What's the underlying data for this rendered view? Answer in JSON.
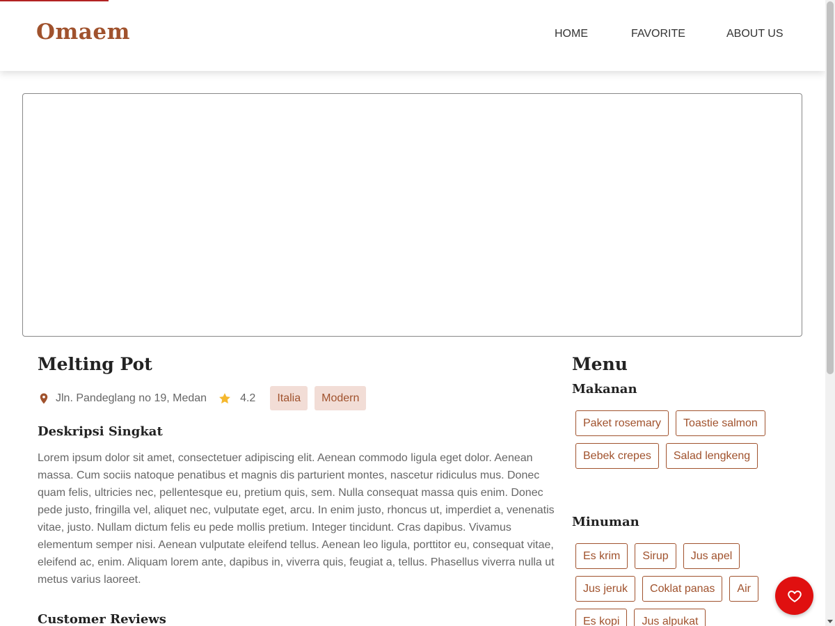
{
  "header": {
    "brand": "Omaem",
    "nav": [
      "HOME",
      "FAVORITE",
      "ABOUT US"
    ]
  },
  "restaurant": {
    "name": "Melting Pot",
    "address": "Jln. Pandeglang no 19, Medan",
    "rating": "4.2",
    "categories": [
      "Italia",
      "Modern"
    ],
    "description_heading": "Deskripsi Singkat",
    "description": "Lorem ipsum dolor sit amet, consectetuer adipiscing elit. Aenean commodo ligula eget dolor. Aenean massa. Cum sociis natoque penatibus et magnis dis parturient montes, nascetur ridiculus mus. Donec quam felis, ultricies nec, pellentesque eu, pretium quis, sem. Nulla consequat massa quis enim. Donec pede justo, fringilla vel, aliquet nec, vulputate eget, arcu. In enim justo, rhoncus ut, imperdiet a, venenatis vitae, justo. Nullam dictum felis eu pede mollis pretium. Integer tincidunt. Cras dapibus. Vivamus elementum semper nisi. Aenean vulputate eleifend tellus. Aenean leo ligula, porttitor eu, consequat vitae, eleifend ac, enim. Aliquam lorem ante, dapibus in, viverra quis, feugiat a, tellus. Phasellus viverra nulla ut metus varius laoreet.",
    "reviews_heading": "Customer Reviews"
  },
  "menu": {
    "title": "Menu",
    "foods_heading": "Makanan",
    "foods": [
      "Paket rosemary",
      "Toastie salmon",
      "Bebek crepes",
      "Salad lengkeng"
    ],
    "drinks_heading": "Minuman",
    "drinks": [
      "Es krim",
      "Sirup",
      "Jus apel",
      "Jus jeruk",
      "Coklat panas",
      "Air",
      "Es kopi",
      "Jus alpukat"
    ]
  },
  "icons": {
    "pin": "map-pin-icon",
    "star": "star-icon",
    "favorite": "heart-icon"
  },
  "colors": {
    "brand": "#a0522d",
    "star": "#f5b82e",
    "fab": "#e01010",
    "tag_bg": "#f2ddd6"
  }
}
